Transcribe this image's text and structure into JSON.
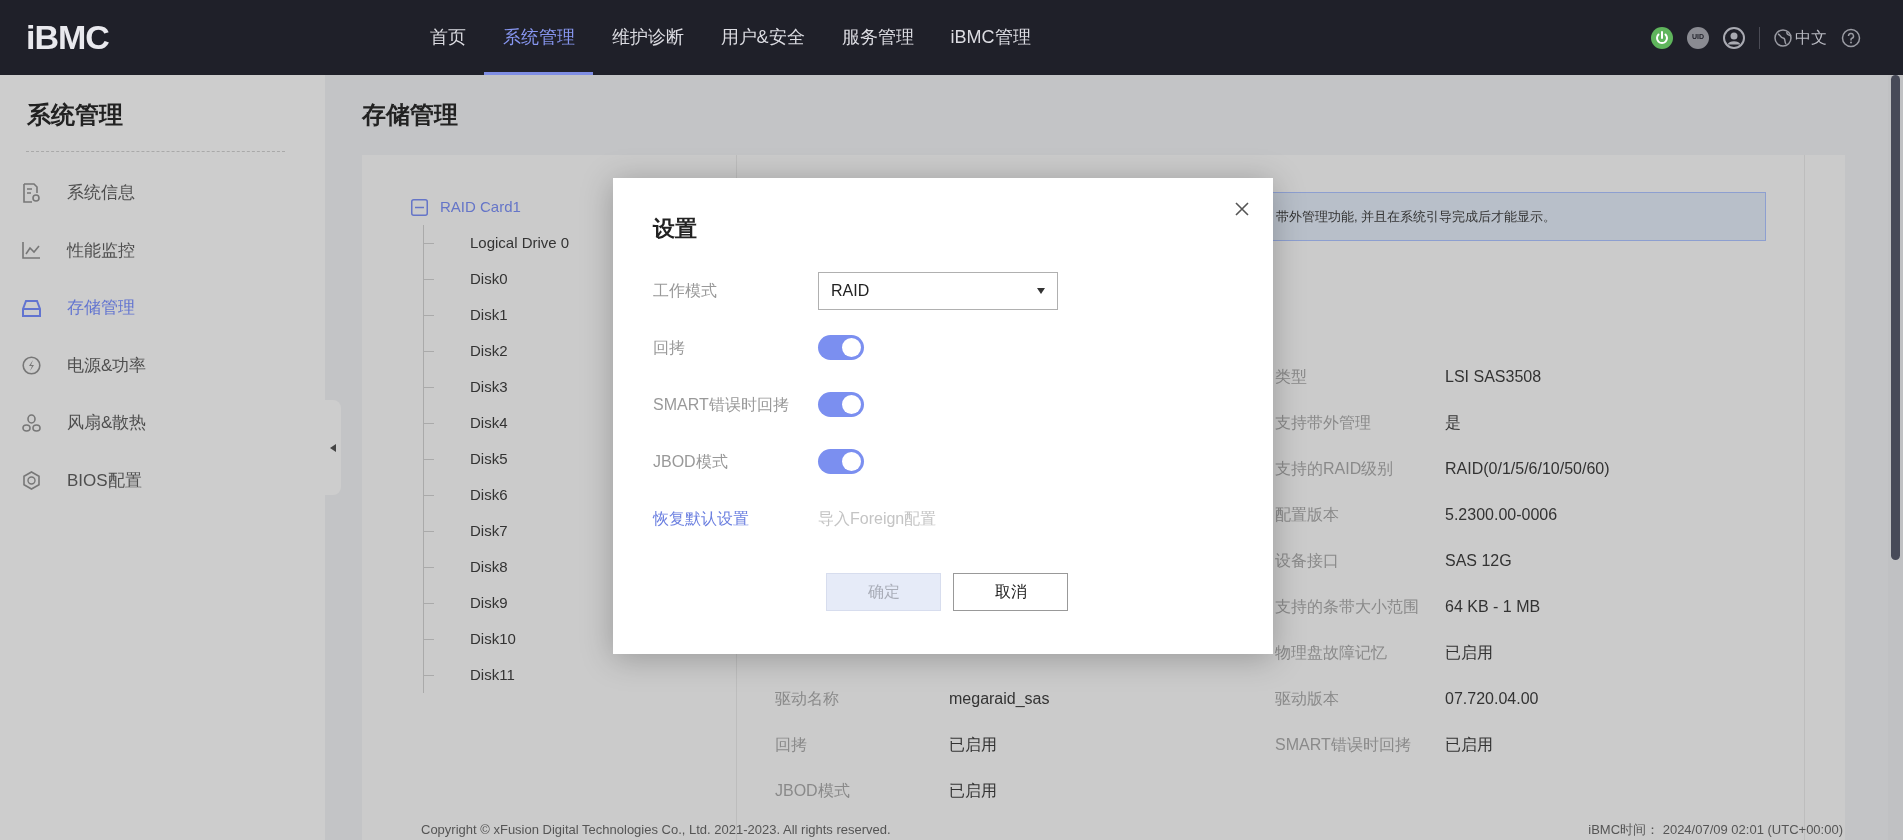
{
  "header": {
    "logo": "iBMC",
    "nav": [
      {
        "label": "首页",
        "selected": false
      },
      {
        "label": "系统管理",
        "selected": true
      },
      {
        "label": "维护诊断",
        "selected": false
      },
      {
        "label": "用户&安全",
        "selected": false
      },
      {
        "label": "服务管理",
        "selected": false
      },
      {
        "label": "iBMC管理",
        "selected": false
      }
    ],
    "uid": "UID",
    "language": "中文"
  },
  "sidebar": {
    "title": "系统管理",
    "items": [
      {
        "label": "系统信息",
        "selected": false
      },
      {
        "label": "性能监控",
        "selected": false
      },
      {
        "label": "存储管理",
        "selected": true
      },
      {
        "label": "电源&功率",
        "selected": false
      },
      {
        "label": "风扇&散热",
        "selected": false
      },
      {
        "label": "BIOS配置",
        "selected": false
      }
    ]
  },
  "page": {
    "title": "存储管理"
  },
  "tree": {
    "label": "RAID Card1",
    "expanded": true,
    "selected": true,
    "children": [
      {
        "label": "Logical Drive 0",
        "selected": false
      },
      {
        "label": "Disk0",
        "selected": false
      },
      {
        "label": "Disk1",
        "selected": false
      },
      {
        "label": "Disk2",
        "selected": false
      },
      {
        "label": "Disk3",
        "selected": false
      },
      {
        "label": "Disk4",
        "selected": false
      },
      {
        "label": "Disk5",
        "selected": false
      },
      {
        "label": "Disk6",
        "selected": false
      },
      {
        "label": "Disk7",
        "selected": false
      },
      {
        "label": "Disk8",
        "selected": false
      },
      {
        "label": "Disk9",
        "selected": false
      },
      {
        "label": "Disk10",
        "selected": false
      },
      {
        "label": "Disk11",
        "selected": false
      }
    ]
  },
  "notice": "带外管理功能, 并且在系统引导完成后才能显示。",
  "properties": {
    "left": [
      {
        "label": "驱动名称",
        "value": "megaraid_sas"
      },
      {
        "label": "回拷",
        "value": "已启用"
      },
      {
        "label": "JBOD模式",
        "value": "已启用"
      }
    ],
    "right": [
      {
        "label": "类型",
        "value": "LSI SAS3508"
      },
      {
        "label": "支持带外管理",
        "value": "是"
      },
      {
        "label": "支持的RAID级别",
        "value": "RAID(0/1/5/6/10/50/60)"
      },
      {
        "label": "配置版本",
        "value": "5.2300.00-0006"
      },
      {
        "label": "设备接口",
        "value": "SAS 12G"
      },
      {
        "label": "支持的条带大小范围",
        "value": "64 KB - 1 MB"
      },
      {
        "label": "物理盘故障记忆",
        "value": "已启用"
      },
      {
        "label": "驱动版本",
        "value": "07.720.04.00"
      },
      {
        "label": "SMART错误时回拷",
        "value": "已启用"
      }
    ]
  },
  "dialog": {
    "title": "设置",
    "fields": [
      {
        "kind": "select",
        "label": "工作模式",
        "value": "RAID"
      },
      {
        "kind": "toggle",
        "label": "回拷",
        "on": true
      },
      {
        "kind": "toggle",
        "label": "SMART错误时回拷",
        "on": true
      },
      {
        "kind": "toggle",
        "label": "JBOD模式",
        "on": true
      }
    ],
    "links": [
      {
        "label": "恢复默认设置",
        "disabled": false
      },
      {
        "label": "导入Foreign配置",
        "disabled": true
      }
    ],
    "buttons": [
      {
        "label": "确定",
        "disabled": true
      },
      {
        "label": "取消",
        "disabled": false
      }
    ]
  },
  "footer": {
    "copyright": "Copyright © xFusion Digital Technologies Co., Ltd. 2021-2023. All rights reserved.",
    "time_label": "iBMC时间：",
    "time": "2024/07/09 02:01 (UTC+00:00)"
  }
}
